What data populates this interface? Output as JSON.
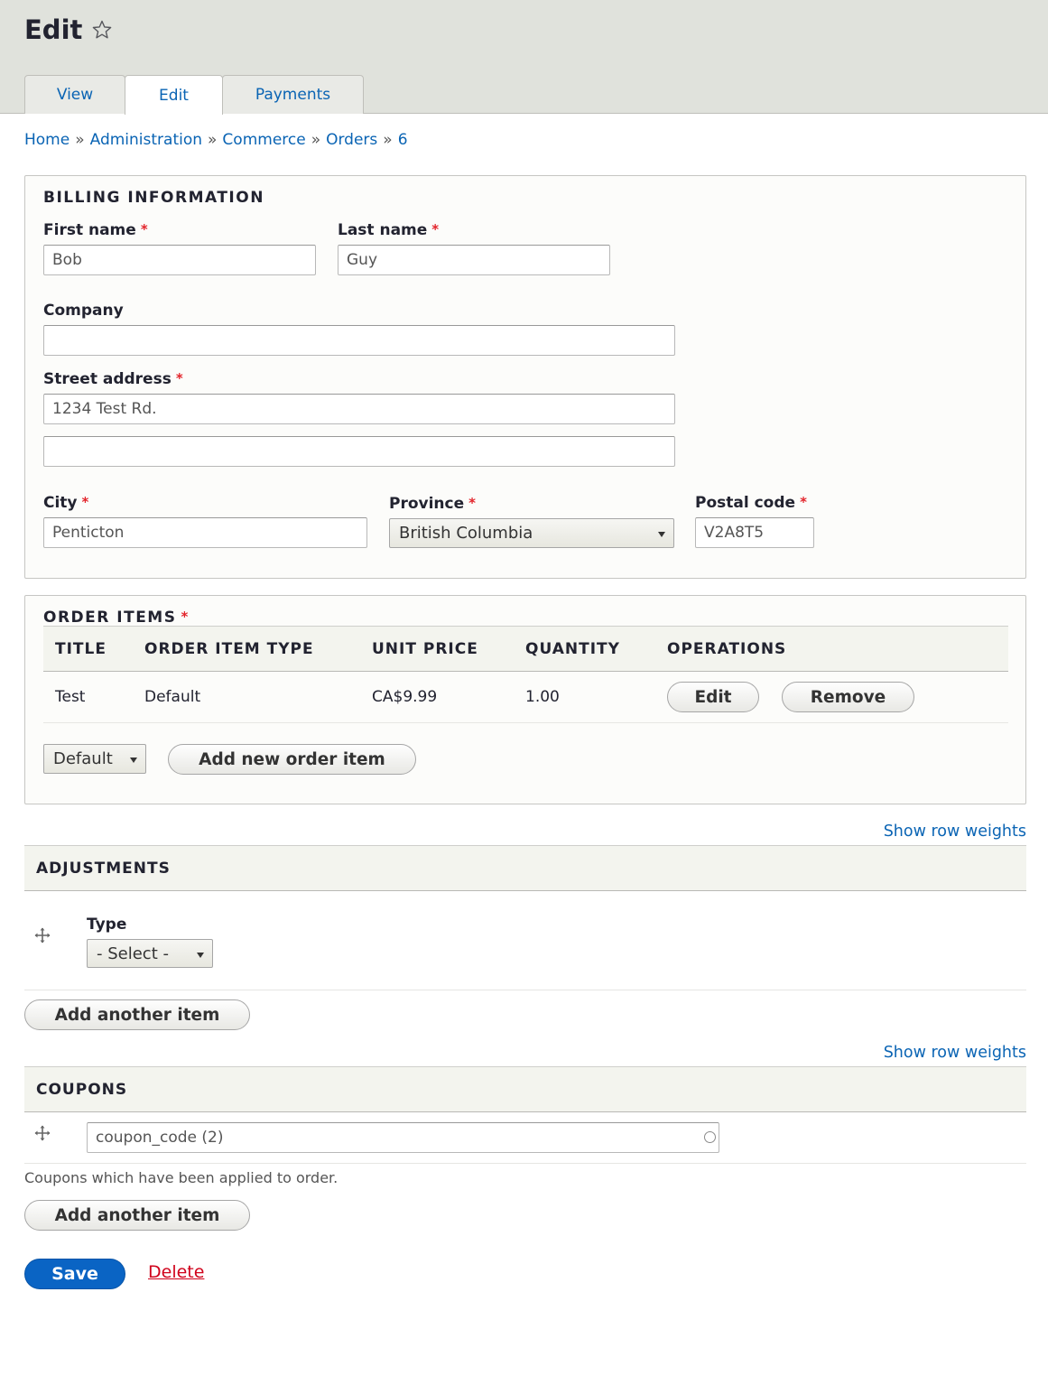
{
  "page": {
    "title": "Edit"
  },
  "tabs": [
    {
      "label": "View",
      "active": false
    },
    {
      "label": "Edit",
      "active": true
    },
    {
      "label": "Payments",
      "active": false
    }
  ],
  "breadcrumb": [
    "Home",
    "Administration",
    "Commerce",
    "Orders",
    "6"
  ],
  "billing": {
    "legend": "BILLING INFORMATION",
    "first_name": {
      "label": "First name",
      "value": "Bob"
    },
    "last_name": {
      "label": "Last name",
      "value": "Guy"
    },
    "company": {
      "label": "Company",
      "value": ""
    },
    "street": {
      "label": "Street address",
      "value": "1234 Test Rd.",
      "value2": ""
    },
    "city": {
      "label": "City",
      "value": "Penticton"
    },
    "province": {
      "label": "Province",
      "value": "British Columbia"
    },
    "postal": {
      "label": "Postal code",
      "value": "V2A8T5"
    },
    "required_mark": "*"
  },
  "order_items": {
    "legend": "ORDER ITEMS",
    "columns": [
      "TITLE",
      "ORDER ITEM TYPE",
      "UNIT PRICE",
      "QUANTITY",
      "OPERATIONS"
    ],
    "rows": [
      {
        "title": "Test",
        "type": "Default",
        "unit_price": "CA$9.99",
        "quantity": "1.00",
        "edit_label": "Edit",
        "remove_label": "Remove"
      }
    ],
    "type_select": "Default",
    "add_label": "Add new order item"
  },
  "adjustments": {
    "show_weights": "Show row weights",
    "heading": "ADJUSTMENTS",
    "type_label": "Type",
    "type_select": "- Select -",
    "add_label": "Add another item"
  },
  "coupons": {
    "show_weights": "Show row weights",
    "heading": "COUPONS",
    "value": "coupon_code (2)",
    "description": "Coupons which have been applied to order.",
    "add_label": "Add another item"
  },
  "actions": {
    "save": "Save",
    "delete": "Delete"
  },
  "colors": {
    "link": "#0a64b4",
    "primary": "#0a64c4",
    "danger": "#d0021b",
    "required": "#e3242b"
  }
}
